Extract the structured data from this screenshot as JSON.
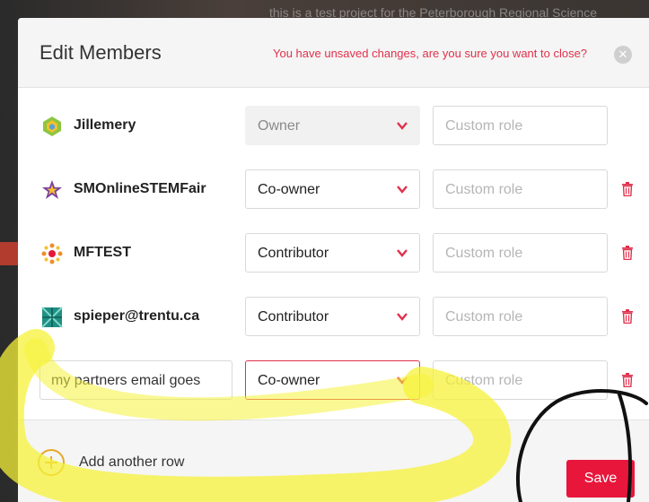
{
  "background": {
    "text": "this is a test project for the Peterborough Regional Science"
  },
  "modal": {
    "title": "Edit Members",
    "unsaved_warning": "You have unsaved changes, are you sure you want to close?",
    "close_symbol": "✕"
  },
  "members": [
    {
      "name": "Jillemery",
      "role": "Owner",
      "custom_role_placeholder": "Custom role",
      "avatar_icon": "green-geometric-avatar-icon",
      "deletable": false
    },
    {
      "name": "SMOnlineSTEMFair",
      "role": "Co-owner",
      "custom_role_placeholder": "Custom role",
      "avatar_icon": "purple-star-avatar-icon",
      "deletable": true
    },
    {
      "name": "MFTEST",
      "role": "Contributor",
      "custom_role_placeholder": "Custom role",
      "avatar_icon": "orange-dots-avatar-icon",
      "deletable": true
    },
    {
      "name": "spieper@trentu.ca",
      "role": "Contributor",
      "custom_role_placeholder": "Custom role",
      "avatar_icon": "teal-pattern-avatar-icon",
      "deletable": true
    }
  ],
  "new_row": {
    "email_value": "my partners email goes",
    "role": "Co-owner",
    "custom_role_placeholder": "Custom role"
  },
  "footer": {
    "add_row_label": "Add another row",
    "save_label": "Save"
  },
  "colors": {
    "accent": "#e8163b",
    "warning": "#e0314c",
    "add_icon": "#e7a72a",
    "highlight": "#f5f23a"
  }
}
